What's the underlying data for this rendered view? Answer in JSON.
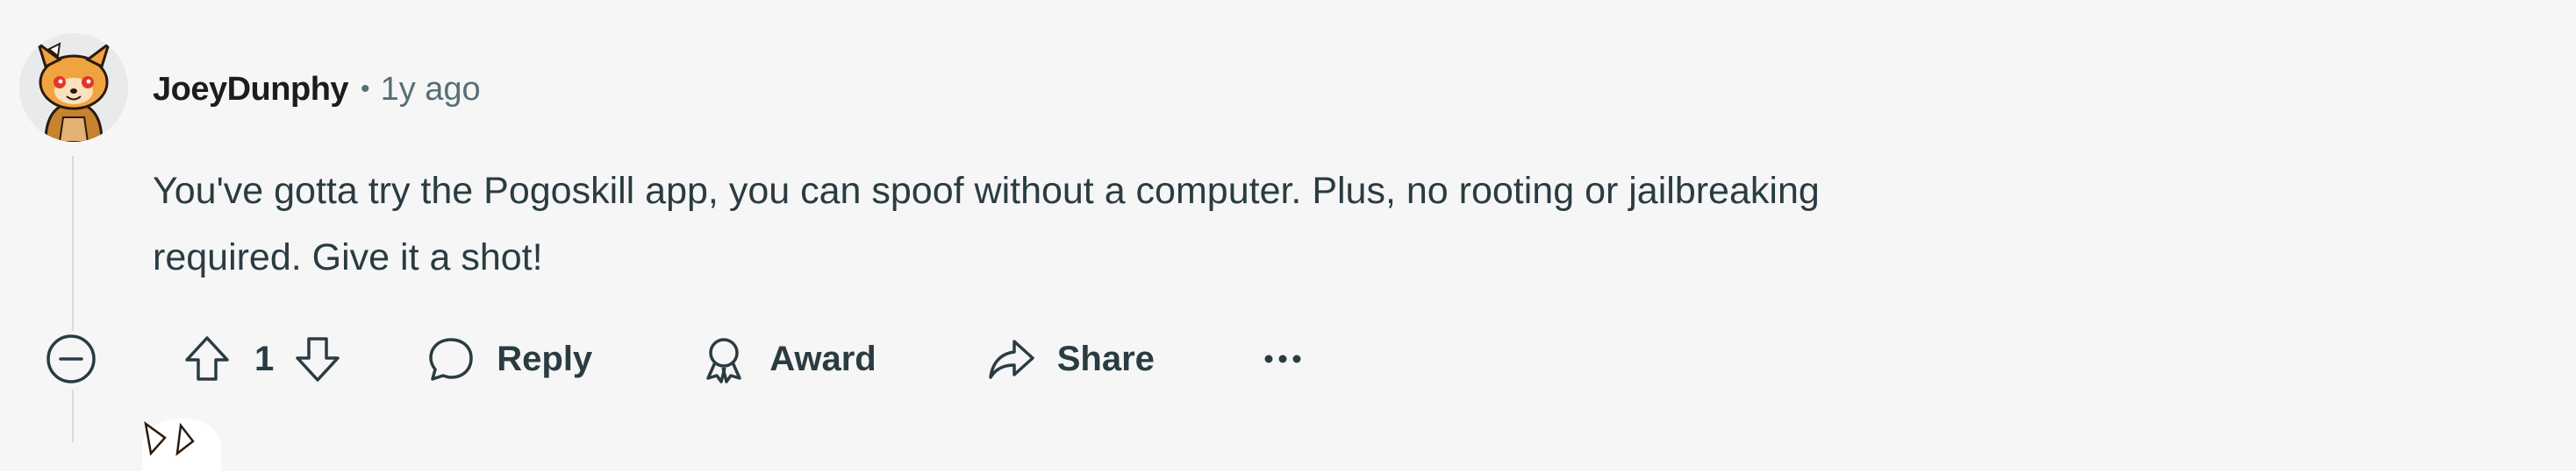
{
  "comment": {
    "author": "JoeyDunphy",
    "separator": "•",
    "timestamp": "1y ago",
    "body_lines": [
      "You've gotta try the Pogoskill app, you can spoof without a computer. Plus, no rooting or jailbreaking",
      "required. Give it a shot!"
    ],
    "score": "1",
    "actions": {
      "reply_label": "Reply",
      "award_label": "Award",
      "share_label": "Share"
    }
  },
  "icons": {
    "avatar": "snoo-avatar-icon",
    "collapse": "collapse-thread-icon",
    "upvote": "upvote-arrow-icon",
    "downvote": "downvote-arrow-icon",
    "reply": "speech-bubble-icon",
    "award": "award-ribbon-icon",
    "share": "share-arrow-icon",
    "more": "more-options-icon"
  },
  "colors": {
    "background": "#f6f6f6",
    "text": "#1c1c1c",
    "muted": "#576f76",
    "thread_line": "#d8dadc"
  }
}
